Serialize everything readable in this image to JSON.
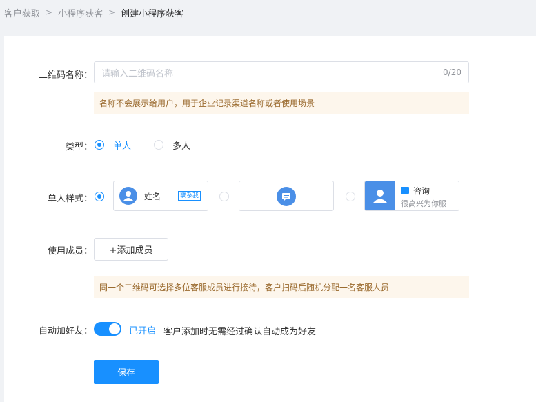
{
  "breadcrumb": {
    "items": [
      "客户获取",
      "小程序获客",
      "创建小程序获客"
    ]
  },
  "form": {
    "name_label": "二维码名称：",
    "name_placeholder": "请输入二维码名称",
    "name_count": "0/20",
    "name_tip": "名称不会展示给用户，用于企业记录渠道名称或者使用场景",
    "type_label": "类型：",
    "type_options": [
      "单人",
      "多人"
    ],
    "type_selected": "单人",
    "style_label": "单人样式：",
    "style_cards": {
      "card1_name": "姓名",
      "card1_badge": "联系我",
      "card3_title": "咨询",
      "card3_sub": "很高兴为你服"
    },
    "members_label": "使用成员：",
    "add_member_button": "+添加成员",
    "members_tip": "同一个二维码可选择多位客服成员进行接待，客户扫码后随机分配一名客服人员",
    "auto_friend_label": "自动加好友：",
    "auto_friend_status": "已开启",
    "auto_friend_desc": "客户添加时无需经过确认自动成为好友",
    "save_button": "保存"
  },
  "colors": {
    "accent": "#1890ff",
    "tip_bg": "#fdf6ec",
    "avatar": "#4a8fe7"
  }
}
